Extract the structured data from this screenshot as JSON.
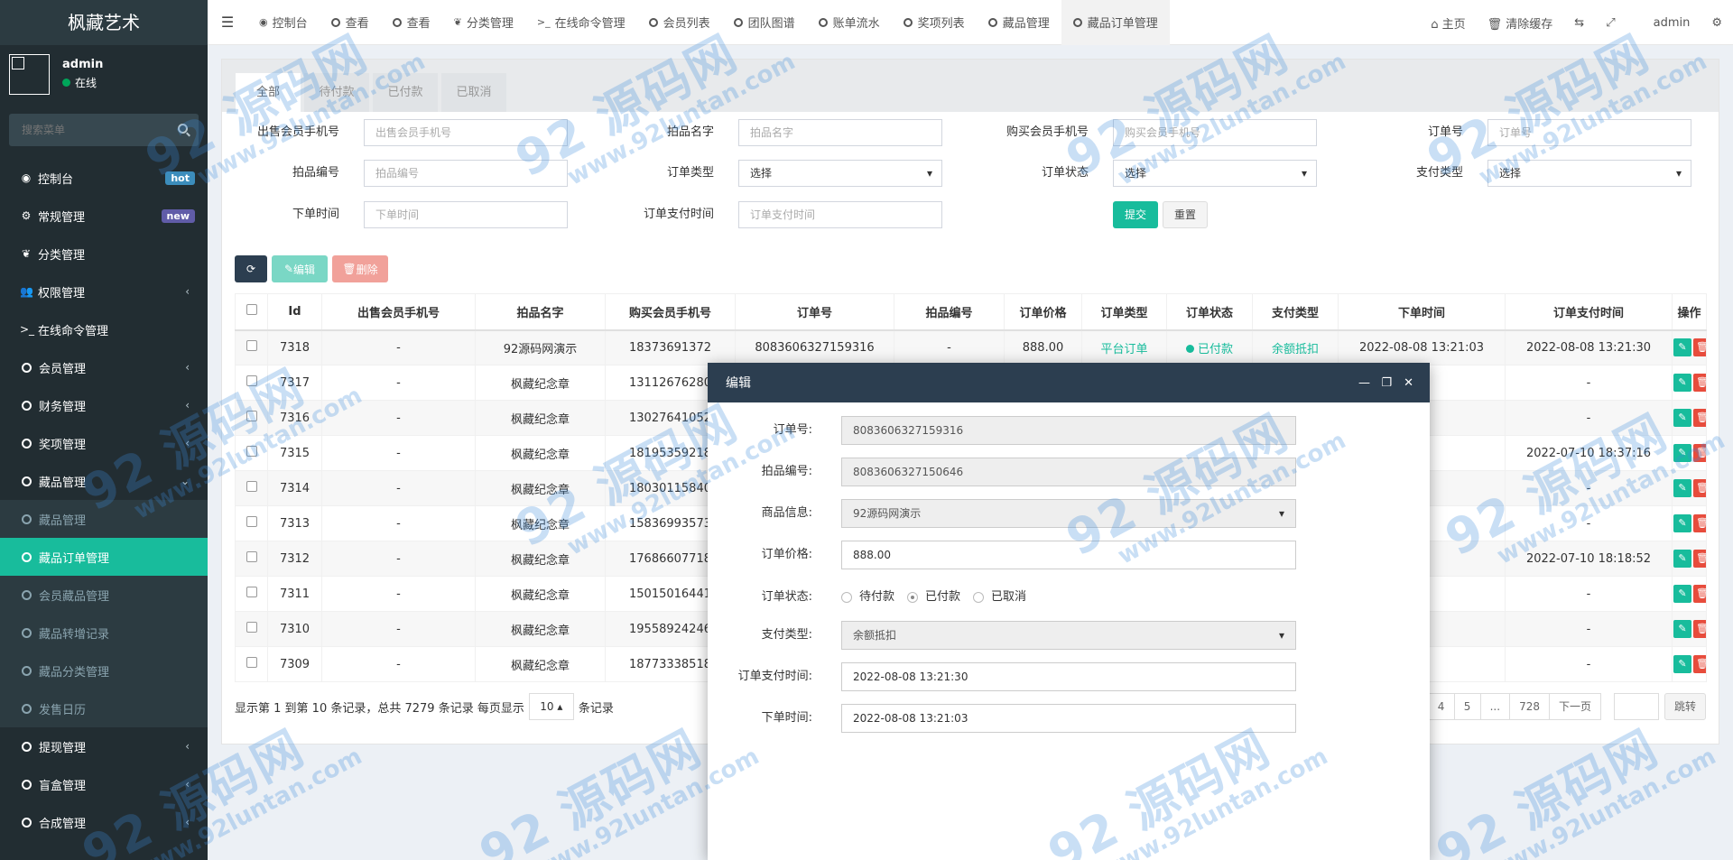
{
  "app": {
    "title": "枫藏艺术"
  },
  "user": {
    "name": "admin",
    "status": "在线"
  },
  "search": {
    "placeholder": "搜索菜单"
  },
  "menu": [
    {
      "label": "控制台",
      "icon": "dashboard-icon",
      "badge": "hot"
    },
    {
      "label": "常规管理",
      "icon": "cogs-icon",
      "badge": "new"
    },
    {
      "label": "分类管理",
      "icon": "leaf-icon"
    },
    {
      "label": "权限管理",
      "icon": "group-icon",
      "arrow": true
    },
    {
      "label": "在线命令管理",
      "icon": "terminal-icon"
    },
    {
      "label": "会员管理",
      "icon": "circle-icon",
      "arrow": true
    },
    {
      "label": "财务管理",
      "icon": "circle-icon",
      "arrow": true
    },
    {
      "label": "奖项管理",
      "icon": "circle-icon",
      "arrow": true
    },
    {
      "label": "藏品管理",
      "icon": "circle-icon",
      "arrow": true,
      "open": true
    }
  ],
  "submenu": [
    {
      "label": "藏品管理"
    },
    {
      "label": "藏品订单管理",
      "active": true
    },
    {
      "label": "会员藏品管理"
    },
    {
      "label": "藏品转增记录"
    },
    {
      "label": "藏品分类管理"
    },
    {
      "label": "发售日历"
    }
  ],
  "menu_after": [
    {
      "label": "提现管理",
      "arrow": true
    },
    {
      "label": "盲盒管理",
      "arrow": true
    },
    {
      "label": "合成管理",
      "arrow": true
    }
  ],
  "topnav": {
    "tabs": [
      {
        "label": "控制台",
        "icon": "dashboard-icon"
      },
      {
        "label": "查看",
        "icon": "circle-icon"
      },
      {
        "label": "查看",
        "icon": "circle-icon"
      },
      {
        "label": "分类管理",
        "icon": "leaf-icon"
      },
      {
        "label": "在线命令管理",
        "icon": "terminal-icon"
      },
      {
        "label": "会员列表",
        "icon": "circle-icon"
      },
      {
        "label": "团队图谱",
        "icon": "circle-icon"
      },
      {
        "label": "账单流水",
        "icon": "circle-icon"
      },
      {
        "label": "奖项列表",
        "icon": "circle-icon"
      },
      {
        "label": "藏品管理",
        "icon": "circle-icon"
      },
      {
        "label": "藏品订单管理",
        "icon": "circle-icon",
        "active": true
      }
    ],
    "home": "主页",
    "clear_cache": "清除缓存",
    "admin": "admin"
  },
  "status_tabs": [
    "全部",
    "待付款",
    "已付款",
    "已取消"
  ],
  "filters": {
    "seller_phone": {
      "label": "出售会员手机号",
      "placeholder": "出售会员手机号"
    },
    "item_name": {
      "label": "拍品名字",
      "placeholder": "拍品名字"
    },
    "buyer_phone": {
      "label": "购买会员手机号",
      "placeholder": "购买会员手机号"
    },
    "order_no": {
      "label": "订单号",
      "placeholder": "订单号"
    },
    "item_no": {
      "label": "拍品编号",
      "placeholder": "拍品编号"
    },
    "order_type": {
      "label": "订单类型",
      "value": "选择"
    },
    "order_status": {
      "label": "订单状态",
      "value": "选择"
    },
    "pay_type": {
      "label": "支付类型",
      "value": "选择"
    },
    "order_time": {
      "label": "下单时间",
      "placeholder": "下单时间"
    },
    "pay_time": {
      "label": "订单支付时间",
      "placeholder": "订单支付时间"
    },
    "submit": "提交",
    "reset": "重置"
  },
  "toolbar": {
    "edit": "编辑",
    "delete": "删除"
  },
  "table": {
    "headers": [
      "Id",
      "出售会员手机号",
      "拍品名字",
      "购买会员手机号",
      "订单号",
      "拍品编号",
      "订单价格",
      "订单类型",
      "订单状态",
      "支付类型",
      "下单时间",
      "订单支付时间",
      "操作"
    ],
    "rows": [
      {
        "id": "7318",
        "seller": "-",
        "name": "92源码网演示",
        "buyer": "18373691372",
        "order": "8083606327159316",
        "itemno": "-",
        "price": "888.00",
        "type": "平台订单",
        "status": "已付款",
        "pay": "余额抵扣",
        "time": "2022-08-08 13:21:03",
        "paytime": "2022-08-08 13:21:30"
      },
      {
        "id": "7317",
        "seller": "-",
        "name": "枫藏纪念章",
        "buyer": "13112676280",
        "order": "",
        "itemno": "",
        "price": "",
        "type": "",
        "status": "",
        "pay": "",
        "time": "",
        "paytime": "-"
      },
      {
        "id": "7316",
        "seller": "-",
        "name": "枫藏纪念章",
        "buyer": "13027641052",
        "order": "",
        "itemno": "",
        "price": "",
        "type": "",
        "status": "",
        "pay": "",
        "time": "",
        "paytime": "-"
      },
      {
        "id": "7315",
        "seller": "-",
        "name": "枫藏纪念章",
        "buyer": "18195359218",
        "order": "",
        "itemno": "",
        "price": "",
        "type": "",
        "status": "",
        "pay": "",
        "time": "",
        "paytime": "2022-07-10 18:37:16"
      },
      {
        "id": "7314",
        "seller": "-",
        "name": "枫藏纪念章",
        "buyer": "18030115840",
        "order": "",
        "itemno": "",
        "price": "",
        "type": "",
        "status": "",
        "pay": "",
        "time": "",
        "paytime": "-"
      },
      {
        "id": "7313",
        "seller": "-",
        "name": "枫藏纪念章",
        "buyer": "15836993573",
        "order": "",
        "itemno": "",
        "price": "",
        "type": "",
        "status": "",
        "pay": "",
        "time": "",
        "paytime": "-"
      },
      {
        "id": "7312",
        "seller": "-",
        "name": "枫藏纪念章",
        "buyer": "17686607718",
        "order": "",
        "itemno": "",
        "price": "",
        "type": "",
        "status": "",
        "pay": "",
        "time": "",
        "paytime": "2022-07-10 18:18:52"
      },
      {
        "id": "7311",
        "seller": "-",
        "name": "枫藏纪念章",
        "buyer": "15015016441",
        "order": "",
        "itemno": "",
        "price": "",
        "type": "",
        "status": "",
        "pay": "",
        "time": "",
        "paytime": "-"
      },
      {
        "id": "7310",
        "seller": "-",
        "name": "枫藏纪念章",
        "buyer": "19558924246",
        "order": "",
        "itemno": "",
        "price": "",
        "type": "",
        "status": "",
        "pay": "",
        "time": "",
        "paytime": "-"
      },
      {
        "id": "7309",
        "seller": "-",
        "name": "枫藏纪念章",
        "buyer": "18773338518",
        "order": "",
        "itemno": "",
        "price": "",
        "type": "",
        "status": "",
        "pay": "",
        "time": "",
        "paytime": "-"
      }
    ]
  },
  "pagination": {
    "summary_pre": "显示第 1 到第 10 条记录，总共 7279 条记录 每页显示",
    "page_size": "10",
    "summary_post": "条记录",
    "pages": [
      "4",
      "5",
      "...",
      "728",
      "下一页"
    ],
    "jump": "跳转"
  },
  "modal": {
    "title": "编辑",
    "fields": {
      "order_no": {
        "label": "订单号:",
        "value": "8083606327159316"
      },
      "item_no": {
        "label": "拍品编号:",
        "value": "8083606327150646"
      },
      "item_info": {
        "label": "商品信息:",
        "value": "92源码网演示"
      },
      "price": {
        "label": "订单价格:",
        "value": "888.00"
      },
      "status": {
        "label": "订单状态:",
        "options": [
          "待付款",
          "已付款",
          "已取消"
        ],
        "selected": "已付款"
      },
      "pay_type": {
        "label": "支付类型:",
        "value": "余额抵扣"
      },
      "pay_time": {
        "label": "订单支付时间:",
        "value": "2022-08-08 13:21:30"
      },
      "order_time": {
        "label": "下单时间:",
        "value": "2022-08-08 13:21:03"
      }
    }
  },
  "watermark": {
    "big": "92 源码网",
    "small": "www.92luntan.com"
  }
}
